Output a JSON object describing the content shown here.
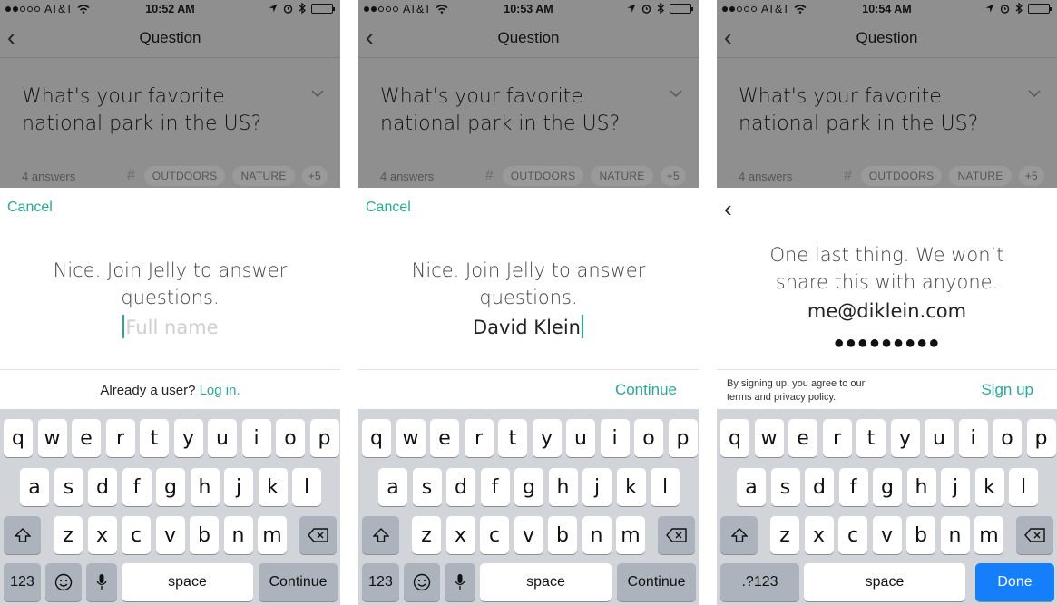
{
  "status": {
    "carrier": "AT&T",
    "times": [
      "10:52 AM",
      "10:53 AM",
      "10:54 AM"
    ]
  },
  "nav": {
    "title": "Question"
  },
  "question": {
    "text": "What's your favorite national park in the US?",
    "answers": "4 answers",
    "tags": [
      "OUTDOORS",
      "NATURE",
      "+5"
    ]
  },
  "screens": [
    {
      "cancel": "Cancel",
      "prompt": "Nice. Join Jelly to answer questions.",
      "field_placeholder": "Full name",
      "already": "Already a user?",
      "login": "Log in.",
      "return_key": "Continue",
      "numbers_key": "123"
    },
    {
      "cancel": "Cancel",
      "prompt": "Nice. Join Jelly to answer questions.",
      "field_value": "David Klein",
      "continue": "Continue",
      "return_key": "Continue",
      "numbers_key": "123"
    },
    {
      "prompt": "One last thing. We won’t share this with anyone.",
      "email": "me@diklein.com",
      "password_mask": "●●●●●●●●●",
      "terms": "By signing up, you agree to our terms and privacy policy.",
      "signup": "Sign up",
      "return_key": "Done",
      "numbers_key": ".?123"
    }
  ],
  "keyboard": {
    "row1": [
      "q",
      "w",
      "e",
      "r",
      "t",
      "y",
      "u",
      "i",
      "o",
      "p"
    ],
    "row2": [
      "a",
      "s",
      "d",
      "f",
      "g",
      "h",
      "j",
      "k",
      "l"
    ],
    "row3": [
      "z",
      "x",
      "c",
      "v",
      "b",
      "n",
      "m"
    ],
    "space": "space"
  },
  "colors": {
    "accent": "#27a996",
    "done_blue": "#147efb",
    "dim_overlay": "#8f8f8f",
    "keyboard_bg": "#d1d4d9"
  }
}
